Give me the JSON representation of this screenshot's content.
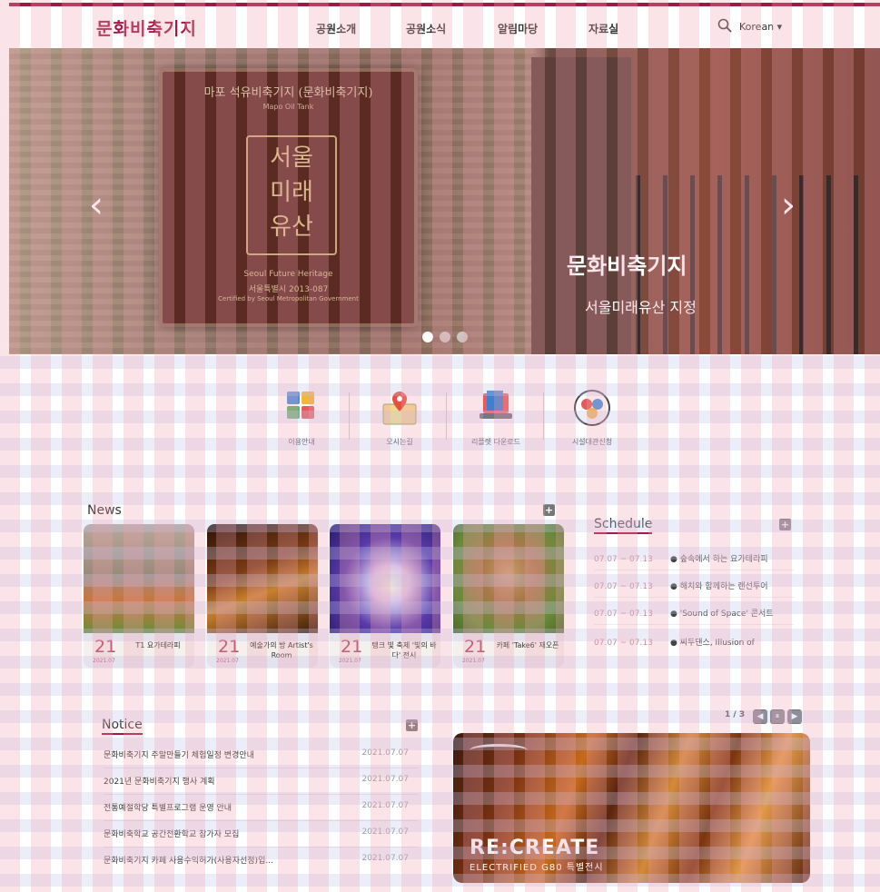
{
  "header": {
    "logo": "문화비축기지",
    "nav": [
      "공원소개",
      "공원소식",
      "알림마당",
      "자료실"
    ],
    "lang": "Korean ▾"
  },
  "hero": {
    "plaque_title": "마포 석유비축기지 (문화비축기지)",
    "plaque_sub": "Mapo Oil Tank",
    "plaque_seal": "서울\n미래\n유산",
    "plaque_en": "Seoul Future Heritage",
    "plaque_no": "서울특별시 2013-087",
    "plaque_cert": "Certified by Seoul Metropolitan Government",
    "caption_logo": "문화비축기지",
    "caption_text": "서울미래유산 지정",
    "prev": "‹",
    "next": "›",
    "slides": 3,
    "active_slide": 1
  },
  "quick_links": [
    {
      "label": "이용안내",
      "icon": "guide-icon"
    },
    {
      "label": "오시는길",
      "icon": "map-pin-icon"
    },
    {
      "label": "리플렛 다운로드",
      "icon": "leaflet-icon"
    },
    {
      "label": "시설대관신청",
      "icon": "facility-icon"
    }
  ],
  "news": {
    "title": "News",
    "more": "+",
    "cards": [
      {
        "day": "21",
        "ym": "2021.07",
        "title": "T1 요가테라피"
      },
      {
        "day": "21",
        "ym": "2021.07",
        "title": "예술가의 방 Artist's Room"
      },
      {
        "day": "21",
        "ym": "2021.07",
        "title": "탱크 빛 축제 '빛의 바다' 전시"
      },
      {
        "day": "21",
        "ym": "2021.07",
        "title": "카페 'Take6' 재오픈"
      }
    ]
  },
  "schedule": {
    "title": "Schedule",
    "more": "+",
    "items": [
      {
        "date": "07.07 ~ 07.13",
        "title": "● 숲속에서 하는 요가테라피"
      },
      {
        "date": "07.07 ~ 07.13",
        "title": "● 해치와 함께하는 랜선투어"
      },
      {
        "date": "07.07 ~ 07.13",
        "title": "● 'Sound of Space' 콘서트"
      },
      {
        "date": "07.07 ~ 07.13",
        "title": "● 씨두댄스, Illusion of"
      }
    ]
  },
  "notice": {
    "title": "Notice",
    "more": "+",
    "items": [
      {
        "title": "문화비축기지 주말만들기 체험일정 변경안내",
        "date": "2021.07.07"
      },
      {
        "title": "2021년 문화비축기지 행사 계획",
        "date": "2021.07.07"
      },
      {
        "title": "전통예절학당 특별프로그램 운영 안내",
        "date": "2021.07.07"
      },
      {
        "title": "문화비축학교 공간전환학교 참가자 모집",
        "date": "2021.07.07"
      },
      {
        "title": "문화비축기지 카페 사용수익허가(사용자선정)입...",
        "date": "2021.07.07"
      }
    ]
  },
  "promo": {
    "pager": "1 / 3",
    "prev": "◀",
    "pause": "⏸",
    "next": "▶",
    "title": "RE:CREATE",
    "subtitle": "ELECTRIFIED G80 특별전시"
  }
}
